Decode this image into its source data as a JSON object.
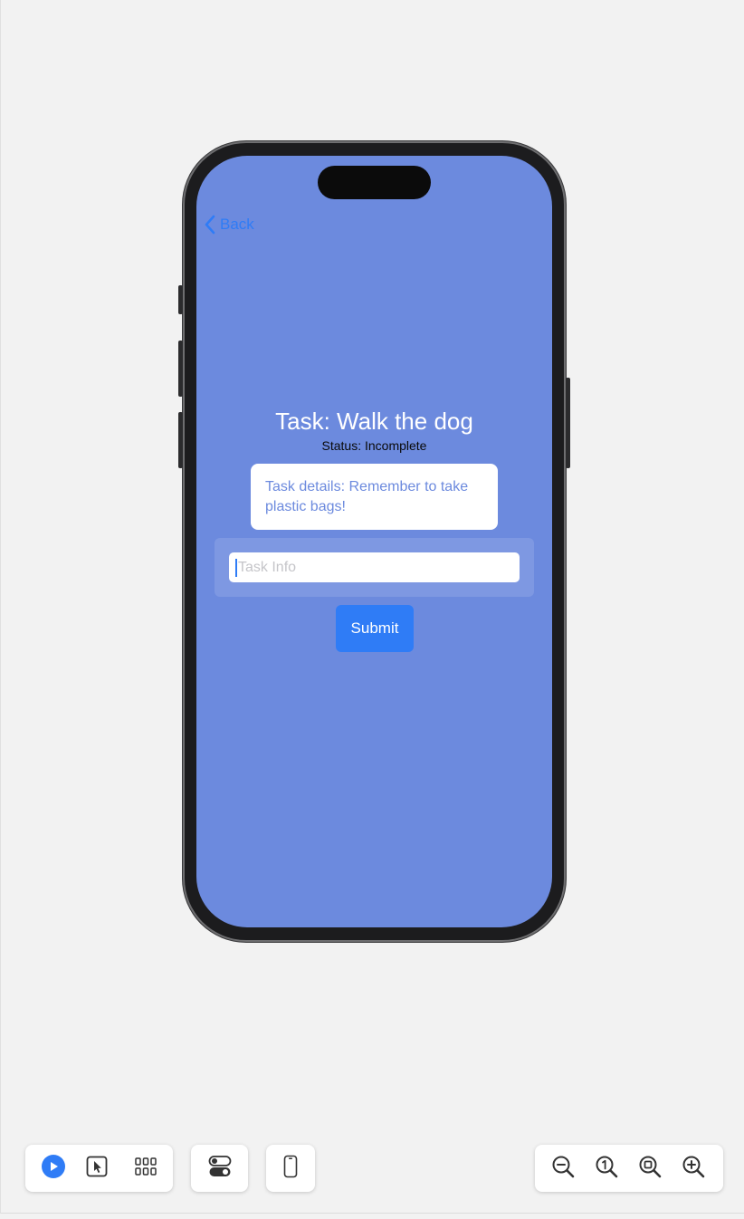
{
  "app": {
    "back_label": "Back",
    "task_title": "Task: Walk the dog",
    "task_status": "Status: Incomplete",
    "task_details": "Task details: Remember to take plastic bags!",
    "input_placeholder": "Task Info",
    "input_value": "",
    "submit_label": "Submit"
  },
  "toolbar": {
    "left_group": [
      {
        "icon": "play-icon",
        "active": true
      },
      {
        "icon": "select-cursor-icon",
        "active": false
      },
      {
        "icon": "grid-icon",
        "active": false
      }
    ],
    "middle_buttons": [
      {
        "icon": "toggle-settings-icon"
      },
      {
        "icon": "device-icon"
      }
    ],
    "zoom_group": [
      {
        "icon": "zoom-out-icon"
      },
      {
        "icon": "zoom-actual-size-icon"
      },
      {
        "icon": "zoom-fit-icon"
      },
      {
        "icon": "zoom-in-icon"
      }
    ]
  },
  "colors": {
    "screen_background": "#6c8ade",
    "accent_blue": "#2f7cf6",
    "canvas_background": "#f2f2f2"
  }
}
